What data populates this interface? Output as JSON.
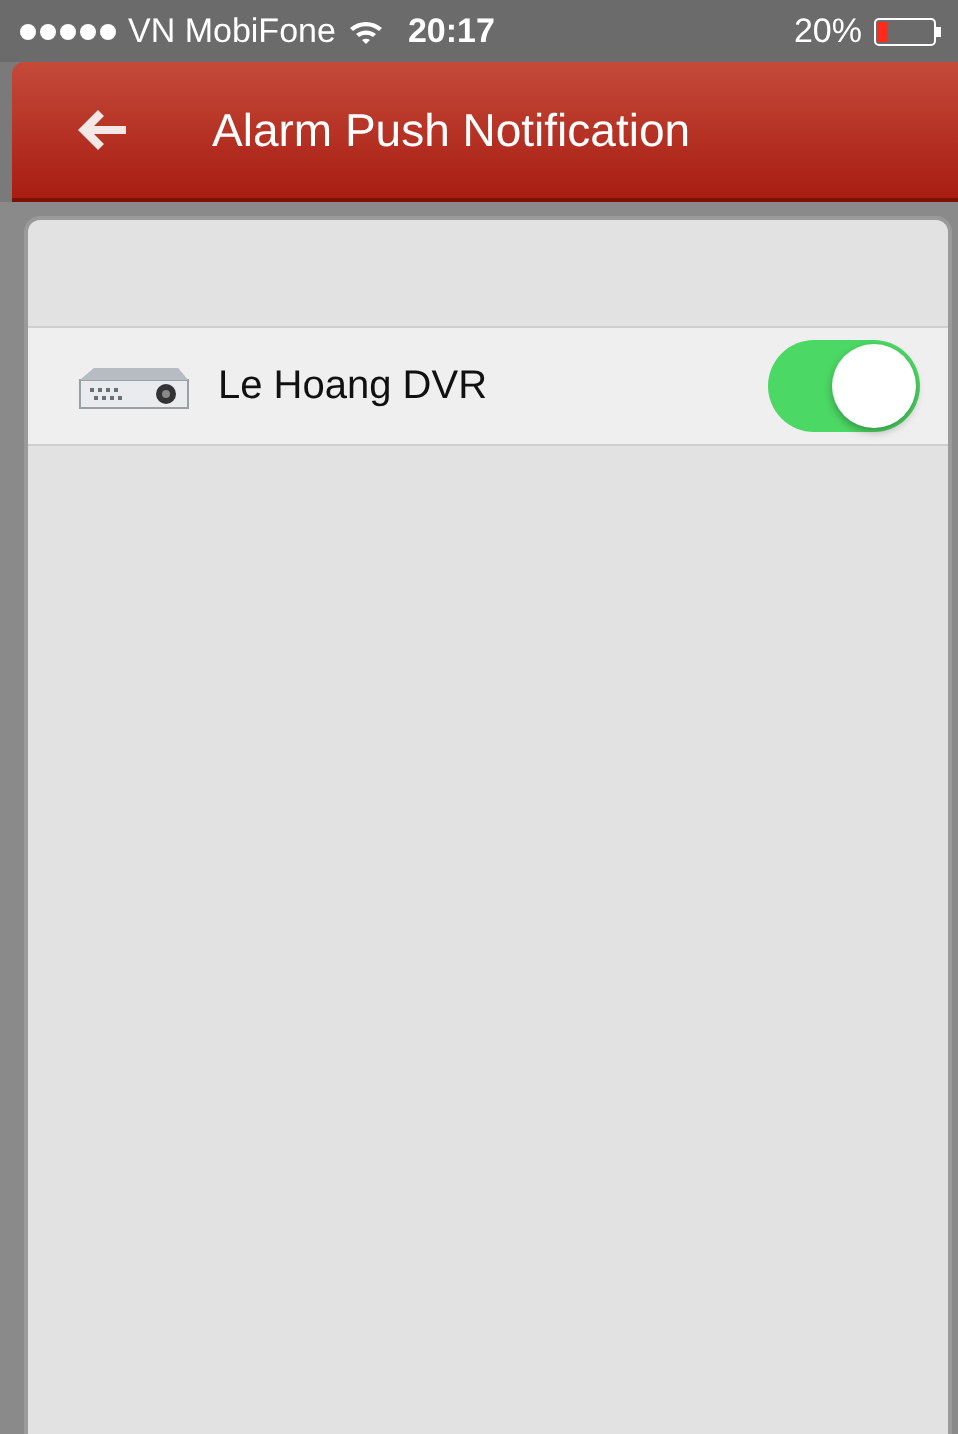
{
  "status_bar": {
    "carrier": "VN MobiFone",
    "time": "20:17",
    "battery": "20%"
  },
  "header": {
    "title": "Alarm Push Notification"
  },
  "devices": [
    {
      "name": "Le Hoang DVR",
      "on": true
    }
  ]
}
